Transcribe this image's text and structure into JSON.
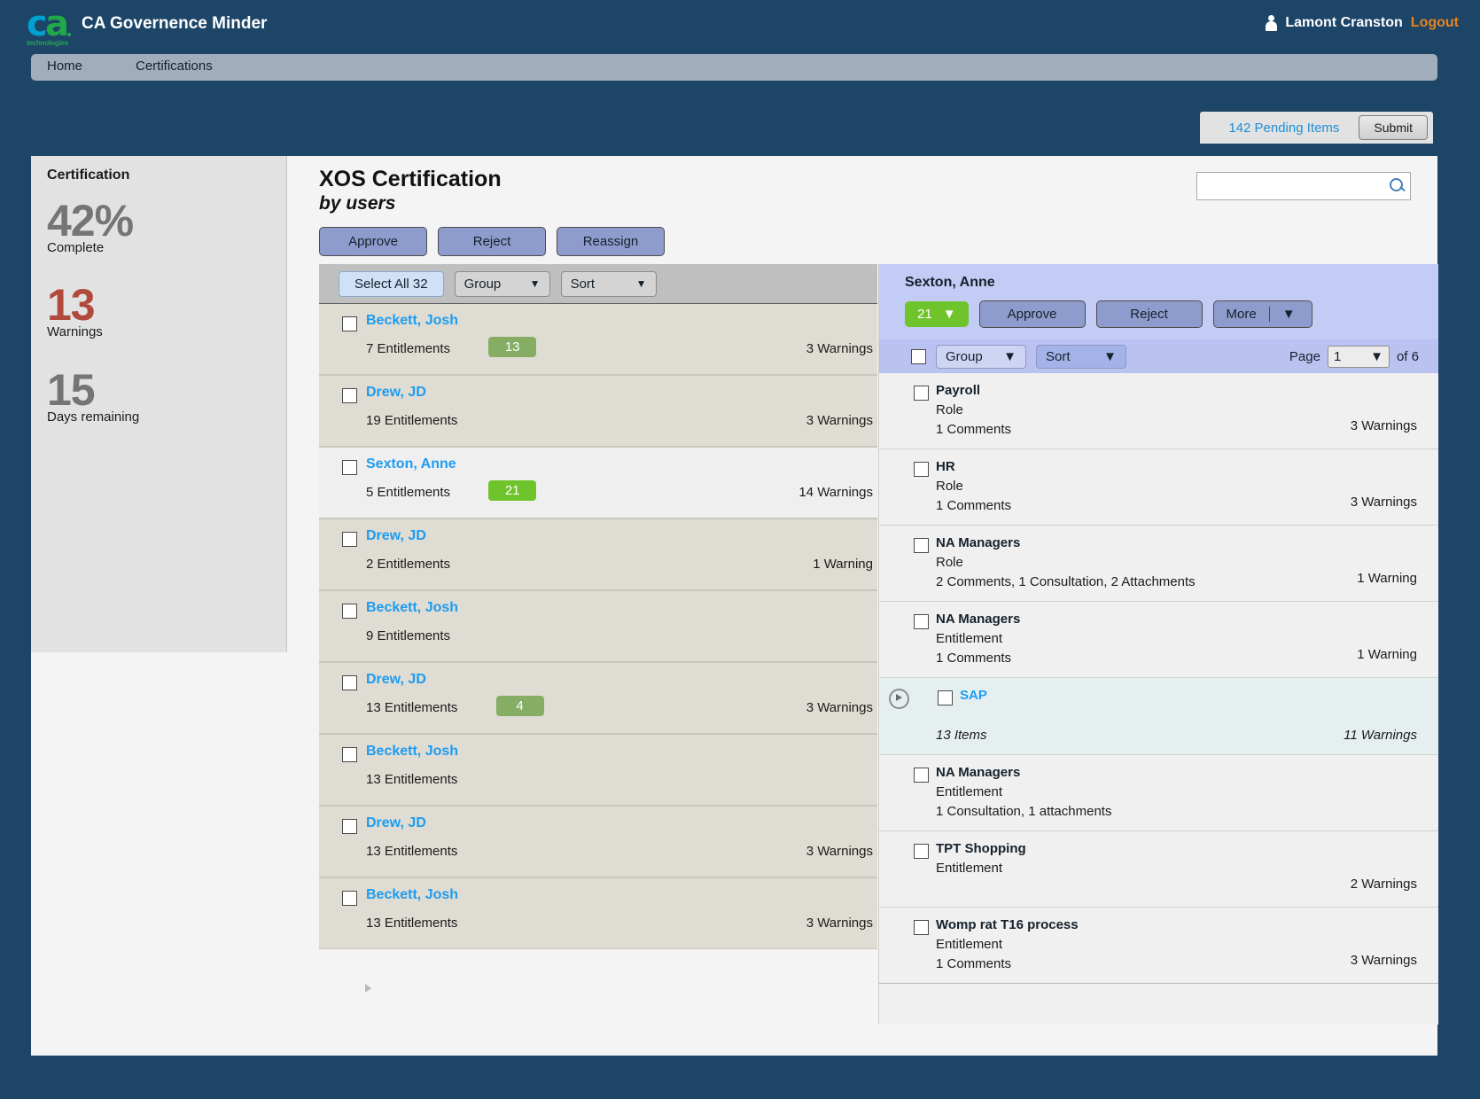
{
  "header": {
    "app_title": "CA Governence Minder",
    "logo_c": "c",
    "logo_a": "a",
    "logo_tech": "technologies",
    "user_name": "Lamont Cranston",
    "logout_label": "Logout"
  },
  "nav": {
    "items": [
      {
        "label": "Home"
      },
      {
        "label": "Certifications"
      }
    ]
  },
  "pending": {
    "label": "142 Pending Items",
    "submit_label": "Submit"
  },
  "sidebar": {
    "title": "Certification",
    "stats": [
      {
        "value": "42%",
        "label": "Complete",
        "color": "#757575"
      },
      {
        "value": "13",
        "label": "Warnings",
        "color": "#b04a3c"
      },
      {
        "value": "15",
        "label": "Days remaining",
        "color": "#757575"
      }
    ]
  },
  "main": {
    "title": "XOS Certification",
    "subtitle": "by users",
    "search_value": "",
    "search_placeholder": "",
    "actions": [
      {
        "label": "Approve"
      },
      {
        "label": "Reject"
      },
      {
        "label": "Reassign"
      }
    ]
  },
  "list_toolbar": {
    "select_all_label": "Select All 32",
    "group_label": "Group",
    "sort_label": "Sort",
    "caret": "▼"
  },
  "users": [
    {
      "name": "Beckett, Josh",
      "entitlements": "7 Entitlements",
      "badge": "13",
      "warnings": "3 Warnings",
      "selected": false
    },
    {
      "name": "Drew, JD",
      "entitlements": "19 Entitlements",
      "badge": "",
      "warnings": "3 Warnings",
      "selected": false
    },
    {
      "name": "Sexton, Anne",
      "entitlements": "5 Entitlements",
      "badge": "21",
      "warnings": "14 Warnings",
      "selected": true
    },
    {
      "name": "Drew, JD",
      "entitlements": "2 Entitlements",
      "badge": "",
      "warnings": "1 Warning",
      "selected": false
    },
    {
      "name": "Beckett, Josh",
      "entitlements": "9 Entitlements",
      "badge": "",
      "warnings": "",
      "selected": false
    },
    {
      "name": "Drew, JD",
      "entitlements": "13 Entitlements",
      "badge": "4",
      "warnings": "3 Warnings",
      "selected": false
    },
    {
      "name": "Beckett, Josh",
      "entitlements": "13 Entitlements",
      "badge": "",
      "warnings": "",
      "selected": false
    },
    {
      "name": "Drew, JD",
      "entitlements": "13 Entitlements",
      "badge": "",
      "warnings": "3 Warnings",
      "selected": false
    },
    {
      "name": "Beckett, Josh",
      "entitlements": "13 Entitlements",
      "badge": "",
      "warnings": "3 Warnings",
      "selected": false
    }
  ],
  "detail": {
    "name": "Sexton, Anne",
    "count_badge": "21",
    "count_caret": "▼",
    "approve_label": "Approve",
    "reject_label": "Reject",
    "more_label": "More",
    "more_caret": "▼",
    "group_label": "Group",
    "sort_label": "Sort",
    "caret": "▼",
    "page_label": "Page",
    "page_value": "1",
    "page_of": "of 6",
    "items": [
      {
        "title": "Payroll",
        "type": "Role",
        "meta": "1 Comments",
        "warnings": "3 Warnings",
        "group": false
      },
      {
        "title": "HR",
        "type": "Role",
        "meta": "1 Comments",
        "warnings": "3 Warnings",
        "group": false
      },
      {
        "title": "NA Managers",
        "type": "Role",
        "meta": "2 Comments, 1 Consultation, 2 Attachments",
        "warnings": "1 Warning",
        "group": false
      },
      {
        "title": "NA Managers",
        "type": "Entitlement",
        "meta": "1 Comments",
        "warnings": "1 Warning",
        "group": false
      },
      {
        "title": "SAP",
        "type": "",
        "meta": "13 Items",
        "warnings": "11 Warnings",
        "group": true
      },
      {
        "title": "NA Managers",
        "type": "Entitlement",
        "meta": "1 Consultation, 1 attachments",
        "warnings": "",
        "group": false
      },
      {
        "title": "TPT Shopping",
        "type": "Entitlement",
        "meta": "",
        "warnings": "2 Warnings",
        "group": false
      },
      {
        "title": "Womp rat T16 process",
        "type": "Entitlement",
        "meta": "1 Comments",
        "warnings": "3 Warnings",
        "group": false
      }
    ]
  }
}
